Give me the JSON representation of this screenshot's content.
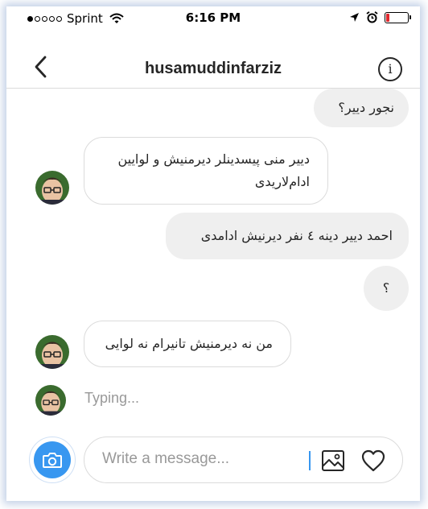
{
  "status_bar": {
    "carrier": "Sprint",
    "time": "6:16 PM",
    "signal_filled": 1,
    "signal_total": 5,
    "battery_level": 0.15,
    "battery_color": "#e0282d",
    "icons": [
      "wifi-icon",
      "location-arrow-icon",
      "alarm-icon",
      "battery-icon"
    ]
  },
  "header": {
    "title": "husamuddinfarziz",
    "back_icon": "chevron-left-icon",
    "info_label": "i"
  },
  "messages": [
    {
      "direction": "outgoing",
      "text": "نجور دییر؟"
    },
    {
      "direction": "incoming",
      "text": "دییر منی پیسدینلر دیرمنیش و لوایین ادام‌لاریدی"
    },
    {
      "direction": "outgoing",
      "text": "احمد دییر دینه ٤ نفر دیرنیش ادامدی"
    },
    {
      "direction": "outgoing",
      "text": "؟"
    },
    {
      "direction": "incoming",
      "text": "من نه دیرمنیش تانیرام نه لوایی"
    }
  ],
  "typing_indicator": "Typing...",
  "composer": {
    "placeholder": "Write a message...",
    "value": "",
    "camera_icon": "camera-icon",
    "gallery_icon": "image-icon",
    "like_icon": "heart-icon"
  },
  "colors": {
    "accent": "#3897f0",
    "outgoing_bubble": "#efefef",
    "incoming_border": "#dbdbdb",
    "text": "#262626",
    "muted": "#999999"
  }
}
